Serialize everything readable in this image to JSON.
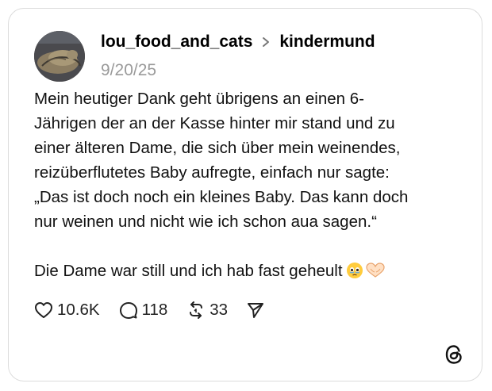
{
  "post": {
    "username": "lou_food_and_cats",
    "community": "kindermund",
    "date": "9/20/25",
    "body": {
      "lines": [
        "Mein heutiger Dank geht übrigens an einen 6-",
        "Jährigen der an der Kasse hinter mir stand und zu",
        "einer älteren Dame, die sich über mein weinendes,",
        "reizüberflutetes Baby aufregte, einfach nur sagte:",
        "„Das ist doch noch ein kleines Baby. Das kann doch",
        "nur weinen und nicht wie ich schon aua sagen.“"
      ],
      "closing": "Die Dame war still und ich hab fast geheult"
    },
    "emojis": [
      "face-holding-back-tears",
      "heart-hands"
    ]
  },
  "actions": {
    "likes": "10.6K",
    "replies": "118",
    "reposts": "33"
  },
  "icons": {
    "like": "heart-icon",
    "reply": "comment-icon",
    "repost": "repost-icon",
    "share": "send-icon",
    "brand": "threads-logo-icon"
  },
  "colors": {
    "text": "#111111",
    "muted": "#9a9a9a",
    "border": "#dcdcdc"
  }
}
